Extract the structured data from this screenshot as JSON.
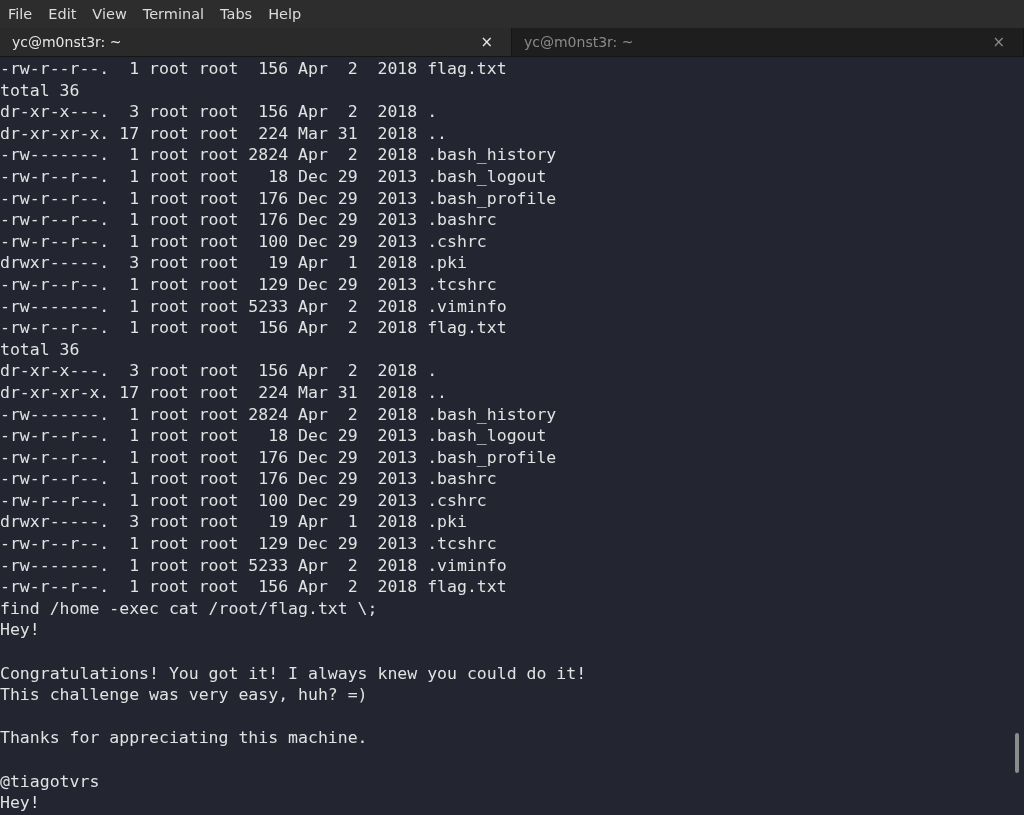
{
  "menu": [
    "File",
    "Edit",
    "View",
    "Terminal",
    "Tabs",
    "Help"
  ],
  "tabs": [
    {
      "title": "yc@m0nst3r: ~",
      "close": "×",
      "selected": true
    },
    {
      "title": "yc@m0nst3r: ~",
      "close": "×",
      "selected": false
    }
  ],
  "terminal": {
    "paragraphs": [
      {
        "lines": [
          "-rw-r--r--.  1 root root  156 Apr  2  2018 flag.txt",
          "total 36",
          "dr-xr-x---.  3 root root  156 Apr  2  2018 .",
          "dr-xr-xr-x. 17 root root  224 Mar 31  2018 ..",
          "-rw-------.  1 root root 2824 Apr  2  2018 .bash_history",
          "-rw-r--r--.  1 root root   18 Dec 29  2013 .bash_logout",
          "-rw-r--r--.  1 root root  176 Dec 29  2013 .bash_profile",
          "-rw-r--r--.  1 root root  176 Dec 29  2013 .bashrc",
          "-rw-r--r--.  1 root root  100 Dec 29  2013 .cshrc",
          "drwxr-----.  3 root root   19 Apr  1  2018 .pki",
          "-rw-r--r--.  1 root root  129 Dec 29  2013 .tcshrc",
          "-rw-------.  1 root root 5233 Apr  2  2018 .viminfo",
          "-rw-r--r--.  1 root root  156 Apr  2  2018 flag.txt",
          "total 36",
          "dr-xr-x---.  3 root root  156 Apr  2  2018 .",
          "dr-xr-xr-x. 17 root root  224 Mar 31  2018 ..",
          "-rw-------.  1 root root 2824 Apr  2  2018 .bash_history",
          "-rw-r--r--.  1 root root   18 Dec 29  2013 .bash_logout",
          "-rw-r--r--.  1 root root  176 Dec 29  2013 .bash_profile",
          "-rw-r--r--.  1 root root  176 Dec 29  2013 .bashrc",
          "-rw-r--r--.  1 root root  100 Dec 29  2013 .cshrc",
          "drwxr-----.  3 root root   19 Apr  1  2018 .pki",
          "-rw-r--r--.  1 root root  129 Dec 29  2013 .tcshrc",
          "-rw-------.  1 root root 5233 Apr  2  2018 .viminfo",
          "-rw-r--r--.  1 root root  156 Apr  2  2018 flag.txt",
          "find /home -exec cat /root/flag.txt \\;",
          "Hey!"
        ]
      },
      {
        "lines": [
          "Congratulations! You got it! I always knew you could do it!",
          "This challenge was very easy, huh? =)"
        ]
      },
      {
        "lines": [
          "Thanks for appreciating this machine."
        ]
      },
      {
        "lines": [
          "@tiagotvrs",
          "Hey!"
        ]
      }
    ]
  }
}
